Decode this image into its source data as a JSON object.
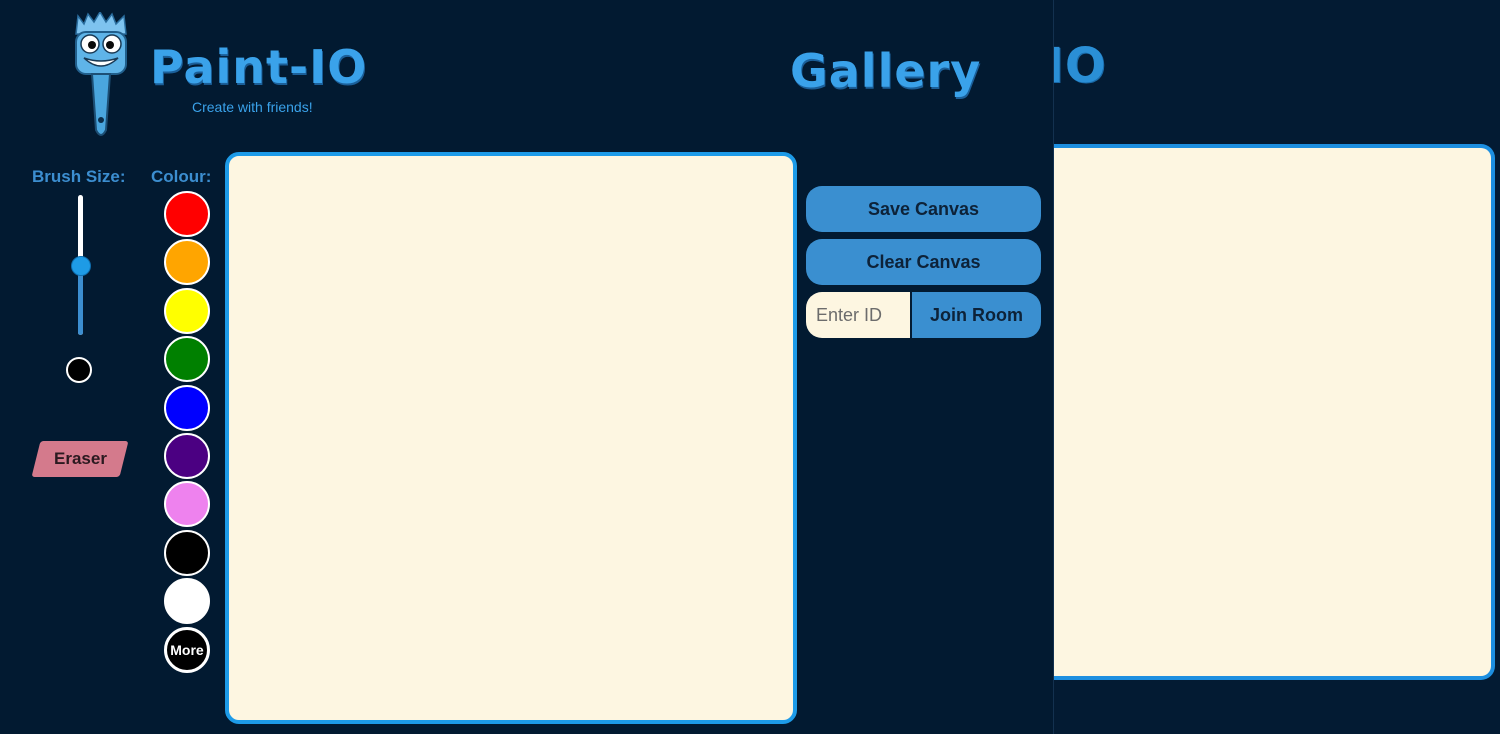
{
  "header": {
    "app_title": "Paint-IO",
    "subtitle": "Create with friends!",
    "gallery_title": "Gallery",
    "gallery_fragment": "IO"
  },
  "brush": {
    "label": "Brush Size:",
    "size_level": 0.5,
    "preview_color": "#000000"
  },
  "eraser": {
    "label": "Eraser",
    "color": "#d47a8c"
  },
  "colours": {
    "label": "Colour:",
    "swatches": [
      "#ff0000",
      "#ffa500",
      "#ffff00",
      "#008000",
      "#0000ff",
      "#4b0082",
      "#ee82ee",
      "#000000",
      "#ffffff"
    ],
    "more_label": "More"
  },
  "actions": {
    "save_label": "Save Canvas",
    "clear_label": "Clear Canvas",
    "room_placeholder": "Enter ID",
    "join_label": "Join Room"
  },
  "theme": {
    "background": "#021a31",
    "accent": "#1d9be8",
    "button": "#3a8fd0",
    "canvas": "#fdf6e1"
  }
}
